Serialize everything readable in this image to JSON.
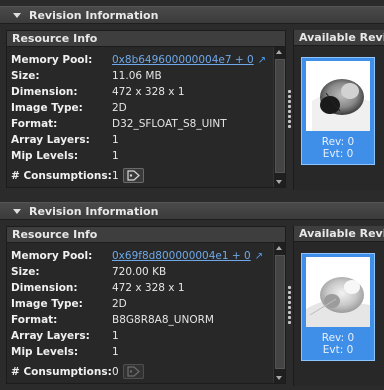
{
  "sections": [
    {
      "title": "Revision Information",
      "resource_info_title": "Resource Info",
      "available_title": "Available Revisions",
      "fields": {
        "memory_pool_label": "Memory Pool:",
        "memory_pool_value": "0x8b649600000004e7 + 0",
        "size_label": "Size:",
        "size_value": "11.06 MB",
        "dimension_label": "Dimension:",
        "dimension_value": "472 x 328 x 1",
        "image_type_label": "Image Type:",
        "image_type_value": "2D",
        "format_label": "Format:",
        "format_value": "D32_SFLOAT_S8_UINT",
        "array_layers_label": "Array Layers:",
        "array_layers_value": "1",
        "mip_levels_label": "Mip Levels:",
        "mip_levels_value": "1",
        "consumptions_label": "# Consumptions:",
        "consumptions_value": "1"
      },
      "revision_card": {
        "rev": "Rev: 0",
        "evt": "Evt: 0"
      }
    },
    {
      "title": "Revision Information",
      "resource_info_title": "Resource Info",
      "available_title": "Available Revisions",
      "fields": {
        "memory_pool_label": "Memory Pool:",
        "memory_pool_value": "0x69f8d800000004e1 + 0",
        "size_label": "Size:",
        "size_value": "720.00 KB",
        "dimension_label": "Dimension:",
        "dimension_value": "472 x 328 x 1",
        "image_type_label": "Image Type:",
        "image_type_value": "2D",
        "format_label": "Format:",
        "format_value": "B8G8R8A8_UNORM",
        "array_layers_label": "Array Layers:",
        "array_layers_value": "1",
        "mip_levels_label": "Mip Levels:",
        "mip_levels_value": "1",
        "consumptions_label": "# Consumptions:",
        "consumptions_value": "0"
      },
      "revision_card": {
        "rev": "Rev: 0",
        "evt": "Evt: 0"
      }
    }
  ],
  "colors": {
    "link": "#6fa8e8",
    "card_bg": "#3f8ee8",
    "card_border": "#8cc4ff"
  },
  "icons": [
    "collapse-triangle-icon",
    "jump-to-icon",
    "tag-icon",
    "splitter-grip-icon"
  ]
}
